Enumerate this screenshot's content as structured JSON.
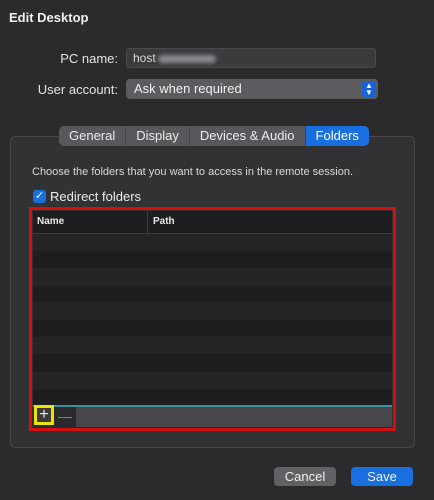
{
  "window": {
    "title": "Edit Desktop"
  },
  "form": {
    "pc_name_label": "PC name:",
    "pc_name_value": "host",
    "user_account_label": "User account:",
    "user_account_value": "Ask when required"
  },
  "tabs": [
    {
      "label": "General"
    },
    {
      "label": "Display"
    },
    {
      "label": "Devices & Audio"
    },
    {
      "label": "Folders",
      "active": true
    }
  ],
  "folders": {
    "description": "Choose the folders that you want to access in the remote session.",
    "redirect_label": "Redirect folders",
    "redirect_checked": true,
    "columns": {
      "name": "Name",
      "path": "Path"
    },
    "add_label": "+",
    "remove_label": "—"
  },
  "buttons": {
    "cancel": "Cancel",
    "save": "Save"
  },
  "colors": {
    "accent": "#1a6fe0",
    "highlight_red": "#d21010",
    "highlight_yellow": "#e6e600"
  }
}
